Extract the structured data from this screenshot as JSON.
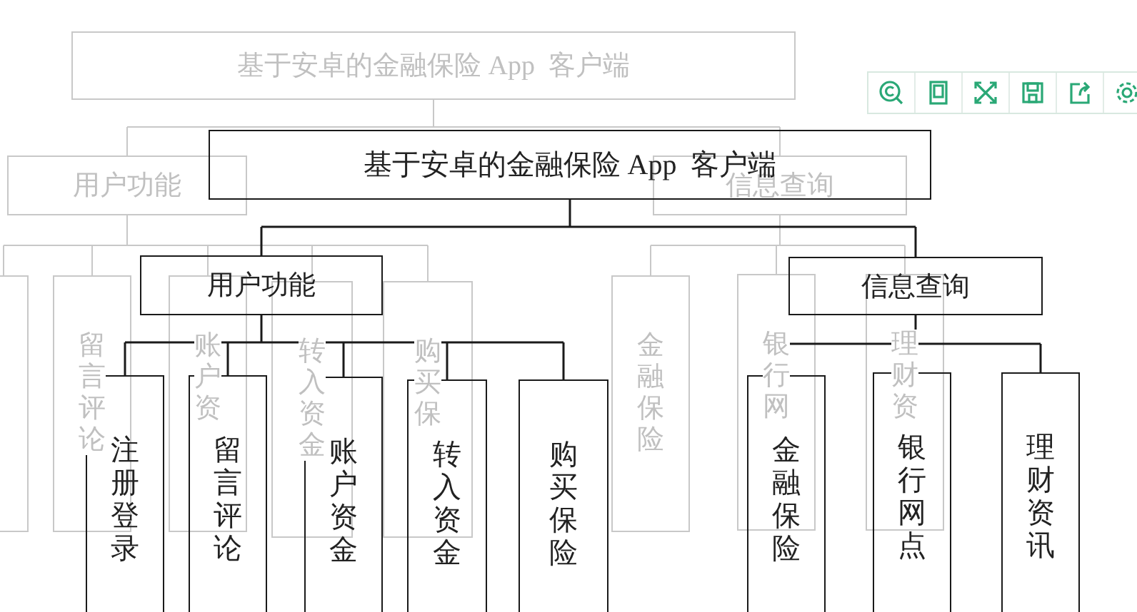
{
  "ghost_diagram": {
    "label": "基于安卓的金融保险 App  客户端",
    "children": [
      {
        "label": "用户功能",
        "children": [
          {
            "label": "留言评论"
          },
          {
            "label": "账户资"
          },
          {
            "label": "转入资金"
          },
          {
            "label": "购买保"
          }
        ]
      },
      {
        "label": "信息查询",
        "children": [
          {
            "label": "金融保险"
          },
          {
            "label": "银行网"
          },
          {
            "label": "理财资"
          }
        ]
      }
    ]
  },
  "diagram": {
    "label": "基于安卓的金融保险 App  客户端",
    "children": [
      {
        "label": "用户功能",
        "children": [
          {
            "label": "注册登录"
          },
          {
            "label": "留言评论"
          },
          {
            "label": "账户资金"
          },
          {
            "label": "转入资金"
          },
          {
            "label": "购买保险"
          }
        ]
      },
      {
        "label": "信息查询",
        "children": [
          {
            "label": "金融保险"
          },
          {
            "label": "银行网点"
          },
          {
            "label": "理财资讯"
          }
        ]
      }
    ]
  },
  "toolbar": {
    "buttons": [
      {
        "kind": "zoom"
      },
      {
        "kind": "page"
      },
      {
        "kind": "fullscreen"
      },
      {
        "kind": "save"
      },
      {
        "kind": "share"
      },
      {
        "kind": "settings"
      }
    ]
  }
}
